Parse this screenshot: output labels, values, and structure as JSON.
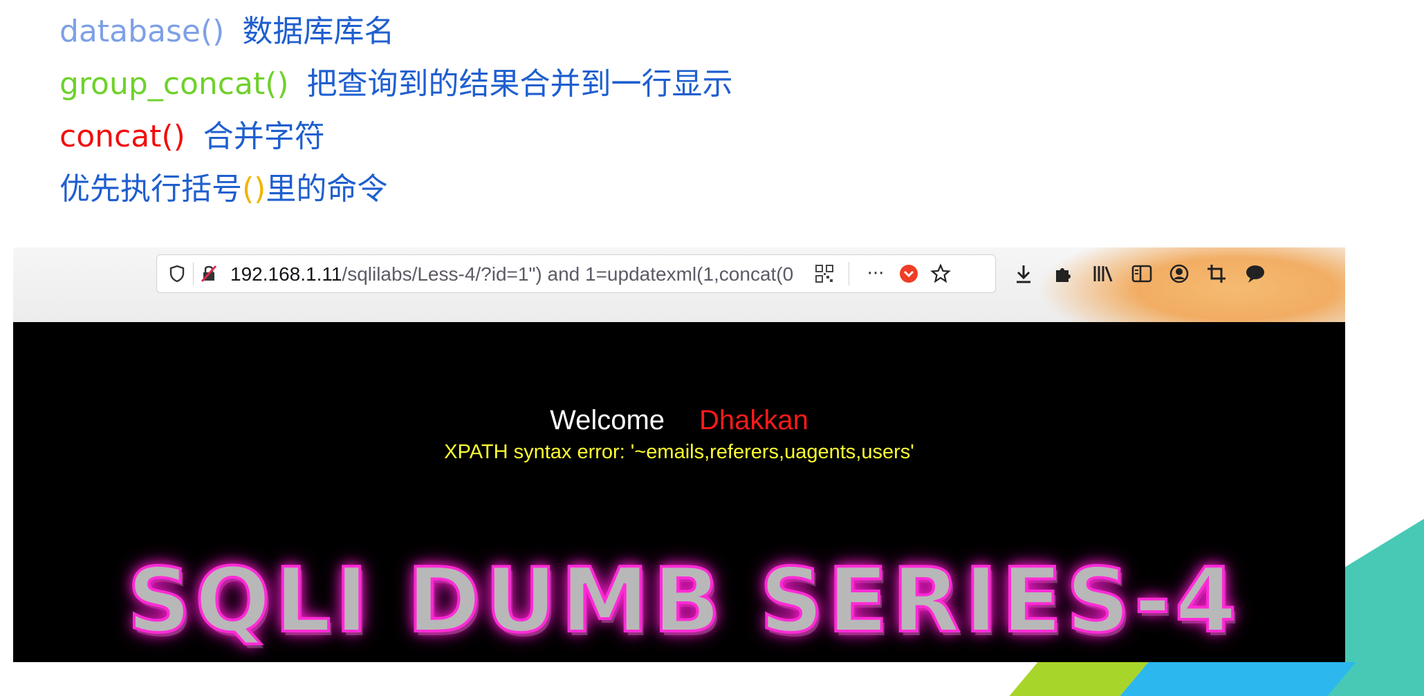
{
  "notes": [
    {
      "fn": "database()",
      "desc": "数据库库名"
    },
    {
      "fn": "group_concat()",
      "desc": "把查询到的结果合并到一行显示"
    },
    {
      "fn": "concat()",
      "desc": "合并字符"
    }
  ],
  "note4": {
    "before": "优先执行括号",
    "paren": "()",
    "after": "里的命令"
  },
  "browser": {
    "url_host": "192.168.1.11",
    "url_path": "/sqlilabs/Less-4/?id=1\") and 1=updatexml(1,concat(0",
    "more_icon": "···",
    "toolbar_icons": [
      "download-icon",
      "extensions-icon",
      "library-icon",
      "reader-view-icon",
      "account-icon",
      "screenshot-icon",
      "chat-icon"
    ]
  },
  "page": {
    "welcome": "Welcome",
    "name": "Dhakkan",
    "error": "XPATH syntax error: '~emails,referers,uagents,users'",
    "banner": "SQLI DUMB SERIES-4"
  },
  "colors": {
    "database_fn": "#7ea0e6",
    "group_concat_fn": "#6fd12c",
    "concat_fn": "#f20d0d",
    "desc": "#1f5fcf",
    "paren": "#f0b400",
    "welcome_name": "#ff1a1a",
    "error_text": "#ffff33",
    "banner_glow": "#ff2bd6"
  }
}
